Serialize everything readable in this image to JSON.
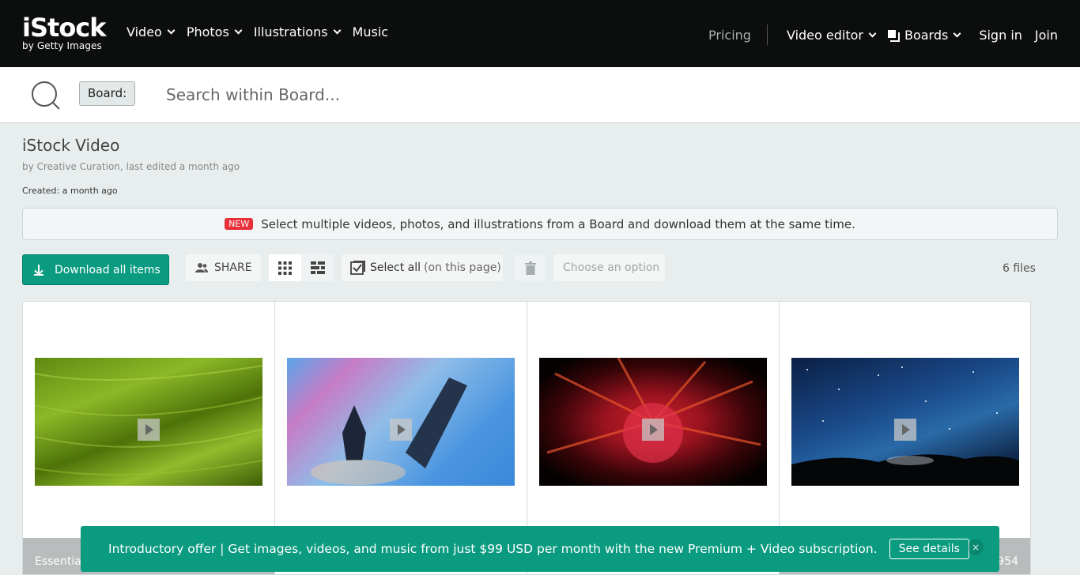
{
  "nav": {
    "logo_main": "iStock",
    "logo_sub": "by Getty Images",
    "left_items": [
      "Video",
      "Photos",
      "Illustrations",
      "Music"
    ],
    "pricing": "Pricing",
    "video_editor": "Video editor",
    "boards": "Boards",
    "sign_in": "Sign in",
    "join": "Join"
  },
  "search": {
    "chip": "Board:",
    "placeholder": "Search within Board..."
  },
  "board": {
    "title": "iStock Video",
    "byline": "by Creative Curation, last edited a month ago",
    "created": "Created: a month ago"
  },
  "notice": {
    "badge": "NEW",
    "text": "Select multiple videos, photos, and illustrations from a Board and download them at the same time."
  },
  "toolbar": {
    "download_all": "Download all items",
    "share": "SHARE",
    "select_all": "Select all",
    "select_all_suffix": "(on this page)",
    "choose_option": "Choose an option",
    "file_count": "6 files"
  },
  "cards": [
    {
      "footer": "Essentia",
      "thumb": "green grass"
    },
    {
      "footer": "",
      "thumb": "skyscrapers in clouds"
    },
    {
      "footer": "",
      "thumb": "red powder explosion"
    },
    {
      "footer": "954",
      "thumb": "milky way night sky"
    }
  ],
  "promo": {
    "text": "Introductory offer | Get images, videos, and music from just $99 USD per month with the new Premium + Video subscription.",
    "button": "See details",
    "close": "×"
  },
  "colors": {
    "accent": "#0b9b80",
    "nav_bg": "#0c0d0d",
    "new_badge": "#e8313a",
    "page_bg": "#e8eeee"
  }
}
